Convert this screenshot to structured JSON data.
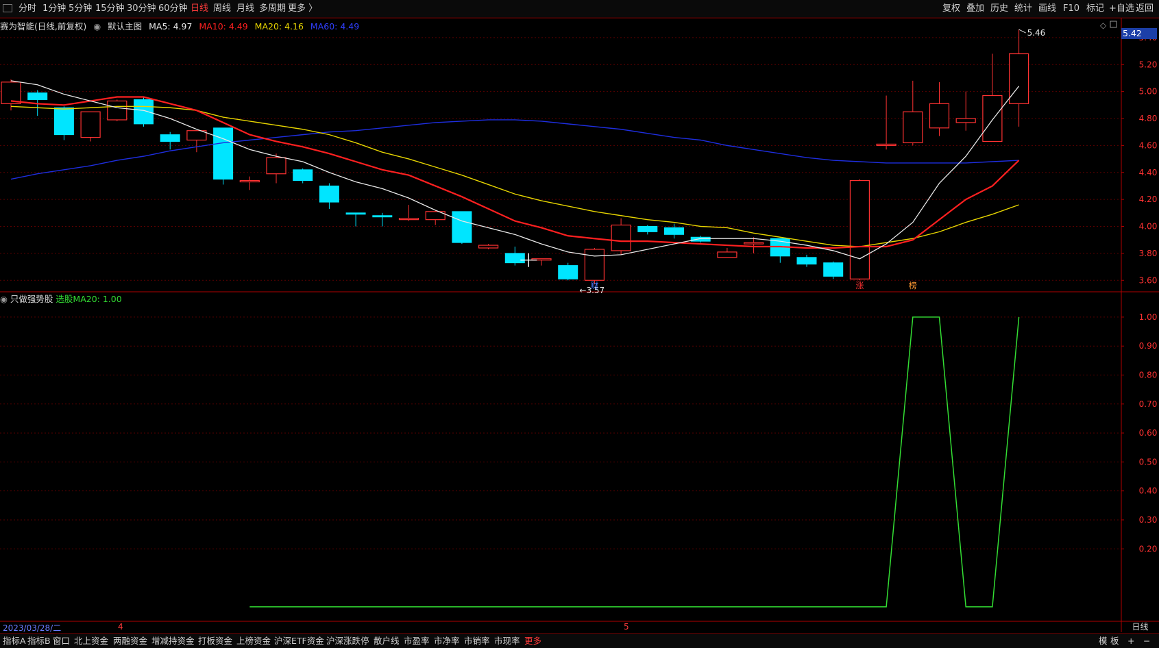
{
  "toolbar": {
    "timeframes": [
      "分时",
      "1分钟",
      "5分钟",
      "15分钟",
      "30分钟",
      "60分钟",
      "日线",
      "周线",
      "月线",
      "多周期",
      "更多 〉"
    ],
    "active_timeframe": "日线",
    "tools": [
      "复权",
      "叠加",
      "历史",
      "统计",
      "画线",
      "F10",
      "标记",
      "+自选",
      "返回"
    ]
  },
  "main_legend": {
    "title": "赛为智能(日线,前复权)",
    "template": "默认主图",
    "ma5": "MA5: 4.97",
    "ma10": "MA10: 4.49",
    "ma20": "MA20: 4.16",
    "ma60": "MA60: 4.49"
  },
  "sub_legend": {
    "title": "只做强势股",
    "value": "选股MA20: 1.00"
  },
  "current_price_label": "5.42",
  "bottom_tabs": [
    "指标A",
    "指标B",
    "窗口",
    "北上资金",
    "两融资金",
    "增减持资金",
    "打板资金",
    "上榜资金",
    "沪深ETF资金",
    "沪深涨跌停",
    "散户线",
    "市盈率",
    "市净率",
    "市销率",
    "市现率",
    "更多"
  ],
  "bottom_right": [
    "模",
    "板",
    "+",
    "−"
  ],
  "date_label": "2023/03/28/二",
  "month_labels": [
    "4",
    "5"
  ],
  "period_label": "日线",
  "colors": {
    "up": "#ff3232",
    "down": "#00e5ff",
    "ma5": "#e8e8e8",
    "ma10": "#ff2020",
    "ma20": "#e6d400",
    "ma60": "#1e2ee0",
    "indicator": "#33dd33",
    "grid": "#5a0000"
  },
  "chart_data": [
    {
      "type": "candlestick",
      "title": "赛为智能(日线,前复权)",
      "y_ticks": [
        "5.40",
        "5.20",
        "5.00",
        "4.80",
        "4.60",
        "4.40",
        "4.20",
        "4.00",
        "3.80",
        "3.60"
      ],
      "ylim": [
        3.52,
        5.44
      ],
      "candles": [
        {
          "o": 4.91,
          "h": 5.09,
          "l": 4.86,
          "c": 5.07
        },
        {
          "o": 4.99,
          "h": 5.01,
          "l": 4.82,
          "c": 4.94
        },
        {
          "o": 4.88,
          "h": 4.89,
          "l": 4.64,
          "c": 4.68
        },
        {
          "o": 4.66,
          "h": 4.85,
          "l": 4.63,
          "c": 4.85
        },
        {
          "o": 4.79,
          "h": 4.94,
          "l": 4.78,
          "c": 4.93
        },
        {
          "o": 4.94,
          "h": 4.96,
          "l": 4.74,
          "c": 4.76
        },
        {
          "o": 4.68,
          "h": 4.7,
          "l": 4.57,
          "c": 4.63
        },
        {
          "o": 4.64,
          "h": 4.7,
          "l": 4.55,
          "c": 4.71
        },
        {
          "o": 4.73,
          "h": 4.73,
          "l": 4.31,
          "c": 4.35
        },
        {
          "o": 4.33,
          "h": 4.37,
          "l": 4.27,
          "c": 4.34
        },
        {
          "o": 4.39,
          "h": 4.54,
          "l": 4.32,
          "c": 4.51
        },
        {
          "o": 4.42,
          "h": 4.43,
          "l": 4.32,
          "c": 4.34
        },
        {
          "o": 4.3,
          "h": 4.32,
          "l": 4.13,
          "c": 4.18
        },
        {
          "o": 4.1,
          "h": 4.1,
          "l": 4.0,
          "c": 4.09
        },
        {
          "o": 4.08,
          "h": 4.1,
          "l": 4.0,
          "c": 4.07
        },
        {
          "o": 4.05,
          "h": 4.16,
          "l": 4.04,
          "c": 4.06
        },
        {
          "o": 4.05,
          "h": 4.12,
          "l": 4.01,
          "c": 4.11
        },
        {
          "o": 4.11,
          "h": 4.11,
          "l": 3.87,
          "c": 3.88
        },
        {
          "o": 3.84,
          "h": 3.87,
          "l": 3.83,
          "c": 3.86
        },
        {
          "o": 3.8,
          "h": 3.85,
          "l": 3.71,
          "c": 3.73
        },
        {
          "o": 3.75,
          "h": 3.76,
          "l": 3.71,
          "c": 3.76
        },
        {
          "o": 3.71,
          "h": 3.73,
          "l": 3.6,
          "c": 3.61
        },
        {
          "o": 3.6,
          "h": 3.84,
          "l": 3.57,
          "c": 3.83
        },
        {
          "o": 3.82,
          "h": 4.06,
          "l": 3.79,
          "c": 4.01
        },
        {
          "o": 4.0,
          "h": 4.01,
          "l": 3.94,
          "c": 3.96
        },
        {
          "o": 3.99,
          "h": 4.02,
          "l": 3.91,
          "c": 3.94
        },
        {
          "o": 3.92,
          "h": 3.93,
          "l": 3.88,
          "c": 3.89
        },
        {
          "o": 3.77,
          "h": 3.84,
          "l": 3.77,
          "c": 3.81
        },
        {
          "o": 3.87,
          "h": 3.92,
          "l": 3.8,
          "c": 3.88
        },
        {
          "o": 3.91,
          "h": 3.91,
          "l": 3.73,
          "c": 3.78
        },
        {
          "o": 3.77,
          "h": 3.79,
          "l": 3.7,
          "c": 3.72
        },
        {
          "o": 3.73,
          "h": 3.74,
          "l": 3.61,
          "c": 3.63
        },
        {
          "o": 3.61,
          "h": 4.35,
          "l": 3.6,
          "c": 4.34
        },
        {
          "o": 4.6,
          "h": 4.97,
          "l": 4.57,
          "c": 4.61
        },
        {
          "o": 4.62,
          "h": 5.08,
          "l": 4.6,
          "c": 4.85
        },
        {
          "o": 4.73,
          "h": 5.07,
          "l": 4.67,
          "c": 4.91
        },
        {
          "o": 4.77,
          "h": 5.0,
          "l": 4.71,
          "c": 4.8
        },
        {
          "o": 4.63,
          "h": 5.28,
          "l": 4.63,
          "c": 4.97
        },
        {
          "o": 4.91,
          "h": 5.46,
          "l": 4.74,
          "c": 5.28
        }
      ],
      "ma5": [
        5.08,
        5.05,
        4.98,
        4.93,
        4.88,
        4.86,
        4.8,
        4.72,
        4.65,
        4.57,
        4.52,
        4.48,
        4.4,
        4.33,
        4.28,
        4.21,
        4.12,
        4.04,
        3.99,
        3.94,
        3.87,
        3.81,
        3.78,
        3.79,
        3.83,
        3.87,
        3.91,
        3.91,
        3.91,
        3.89,
        3.86,
        3.82,
        3.76,
        3.87,
        4.03,
        4.32,
        4.52,
        4.79,
        5.04
      ],
      "ma10": [
        4.93,
        4.91,
        4.9,
        4.93,
        4.96,
        4.96,
        4.91,
        4.86,
        4.77,
        4.68,
        4.63,
        4.59,
        4.54,
        4.48,
        4.42,
        4.38,
        4.3,
        4.22,
        4.13,
        4.04,
        3.99,
        3.93,
        3.91,
        3.89,
        3.89,
        3.88,
        3.87,
        3.86,
        3.85,
        3.85,
        3.84,
        3.84,
        3.85,
        3.85,
        3.9,
        4.05,
        4.2,
        4.3,
        4.49
      ],
      "ma20": [
        4.89,
        4.88,
        4.87,
        4.88,
        4.89,
        4.89,
        4.88,
        4.86,
        4.81,
        4.78,
        4.75,
        4.72,
        4.68,
        4.62,
        4.55,
        4.5,
        4.44,
        4.38,
        4.31,
        4.24,
        4.19,
        4.15,
        4.11,
        4.08,
        4.05,
        4.03,
        4.0,
        3.99,
        3.95,
        3.92,
        3.89,
        3.86,
        3.85,
        3.88,
        3.91,
        3.96,
        4.03,
        4.09,
        4.16
      ],
      "ma60": [
        4.35,
        4.39,
        4.42,
        4.45,
        4.49,
        4.52,
        4.56,
        4.59,
        4.62,
        4.64,
        4.66,
        4.68,
        4.7,
        4.71,
        4.73,
        4.75,
        4.77,
        4.78,
        4.79,
        4.79,
        4.78,
        4.76,
        4.74,
        4.72,
        4.69,
        4.66,
        4.64,
        4.6,
        4.57,
        4.54,
        4.51,
        4.49,
        4.48,
        4.47,
        4.47,
        4.47,
        4.47,
        4.48,
        4.49
      ],
      "annotations": [
        {
          "label": "5.46",
          "candle": 38
        },
        {
          "label": "3.57",
          "candle": 22
        },
        {
          "label": "财",
          "candle": 22
        },
        {
          "label": "涨",
          "candle": 32
        },
        {
          "label": "榜",
          "candle": 34
        }
      ]
    },
    {
      "type": "line",
      "title": "只做强势股",
      "series": [
        {
          "name": "选股MA20",
          "values": [
            0,
            0,
            0,
            0,
            0,
            0,
            0,
            0,
            0,
            0,
            0,
            0,
            0,
            0,
            0,
            0,
            0,
            0,
            0,
            0,
            0,
            0,
            0,
            0,
            0,
            0,
            0,
            0,
            0,
            0,
            0,
            0,
            0,
            0,
            1,
            1,
            0,
            0,
            1
          ]
        }
      ],
      "y_ticks": [
        "1.00",
        "0.90",
        "0.80",
        "0.70",
        "0.60",
        "0.50",
        "0.40",
        "0.30",
        "0.20"
      ],
      "ylim": [
        -0.05,
        1.04
      ]
    }
  ]
}
